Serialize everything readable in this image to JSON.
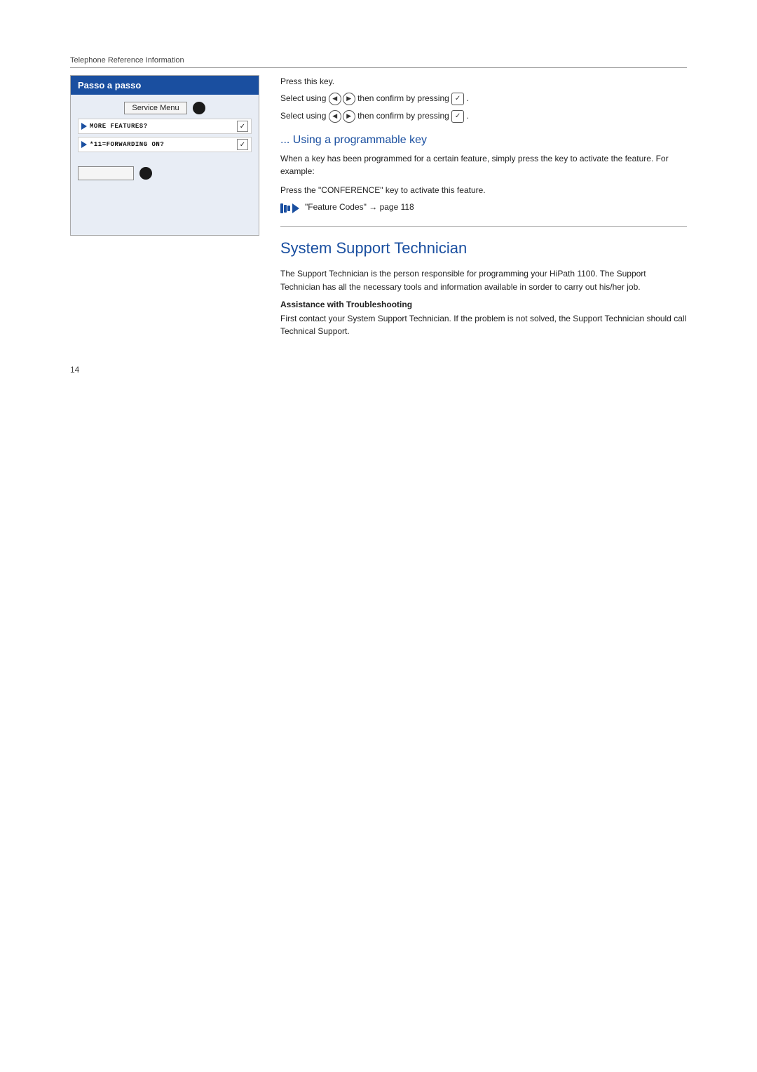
{
  "header": {
    "label": "Telephone Reference Information"
  },
  "left_panel": {
    "box_title": "Passo a passo",
    "service_menu_label": "Service Menu",
    "menu_items": [
      {
        "text": "MORE FEATURES?",
        "has_check": true
      },
      {
        "text": "*11=FORWARDING ON?",
        "has_check": true
      }
    ]
  },
  "right_panel": {
    "step1": "Press this key.",
    "step2_prefix": "Select using ",
    "step2_suffix": " then confirm by pressing ",
    "step3_prefix": "Select using ",
    "step3_suffix": " then confirm by pressing ",
    "subtitle_prefix": "... ",
    "subtitle": "Using a programmable key",
    "programmable_desc": "When a key has been programmed for a certain feature, simply press the key to activate the feature. For example:",
    "programmable_step": "Press the \"CONFERENCE\" key to activate this feature.",
    "note_text": "\"Feature Codes\" → page 118",
    "divider_visible": true
  },
  "main_section": {
    "title": "System Support Technician",
    "body": "The Support Technician is the person responsible for programming your HiPath 1100. The Support Technician has all the necessary tools and information available in sorder to carry out his/her job.",
    "assistance_heading": "Assistance with Troubleshooting",
    "assistance_body": "First contact your System Support Technician. If the problem is not solved, the Support Technician should call Technical Support."
  },
  "footer": {
    "page_number": "14"
  }
}
